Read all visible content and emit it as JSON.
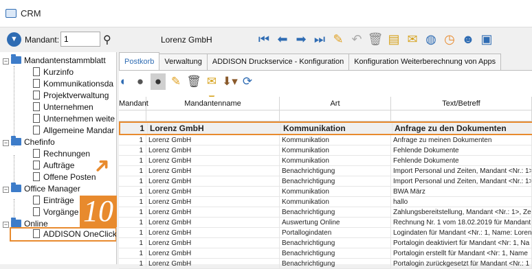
{
  "window": {
    "title": "CRM"
  },
  "toolbar": {
    "mandant_label": "Mandant:",
    "mandant_value": "1",
    "company": "Lorenz GmbH"
  },
  "tree": {
    "groups": [
      {
        "label": "Mandantenstammblatt",
        "items": [
          "Kurzinfo",
          "Kommunikationsda",
          "Projektverwaltung",
          "Unternehmen",
          "Unternehmen weite",
          "Allgemeine Mandar"
        ]
      },
      {
        "label": "Chefinfo",
        "items": [
          "Rechnungen",
          "Aufträge",
          "Offene Posten"
        ]
      },
      {
        "label": "Office Manager",
        "items": [
          "Einträge",
          "Vorgänge"
        ]
      },
      {
        "label": "Online",
        "items": [
          "ADDISON OneClick"
        ]
      }
    ]
  },
  "annotation": {
    "step_number": "10"
  },
  "tabs": [
    {
      "label": "Postkorb",
      "active": true
    },
    {
      "label": "Verwaltung",
      "active": false
    },
    {
      "label": "ADDISON Druckservice - Konfiguration",
      "active": false
    },
    {
      "label": "Konfiguration Weiterberechnung von Apps",
      "active": false
    }
  ],
  "grid": {
    "columns": [
      "Mandant",
      "Mandantenname",
      "Art",
      "Text/Betreff"
    ],
    "rows": [
      [
        "1",
        "Lorenz GmbH",
        "Kommunikation",
        "Anfrage zu den Dokumenten"
      ],
      [
        "1",
        "Lorenz GmbH",
        "Kommunikation",
        "Anfrage zu meinen Dokumenten"
      ],
      [
        "1",
        "Lorenz GmbH",
        "Kommunikation",
        "Fehlende Dokumente"
      ],
      [
        "1",
        "Lorenz GmbH",
        "Kommunikation",
        "Fehlende Dokumente"
      ],
      [
        "1",
        "Lorenz GmbH",
        "Benachrichtigung",
        "Import Personal und Zeiten, Mandant <Nr.: 1>"
      ],
      [
        "1",
        "Lorenz GmbH",
        "Benachrichtigung",
        "Import Personal und Zeiten, Mandant <Nr.: 1>"
      ],
      [
        "1",
        "Lorenz GmbH",
        "Kommunikation",
        "BWA März"
      ],
      [
        "1",
        "Lorenz GmbH",
        "Kommunikation",
        "hallo"
      ],
      [
        "1",
        "Lorenz GmbH",
        "Benachrichtigung",
        "Zahlungsbereitstellung, Mandant <Nr.: 1>, Ze"
      ],
      [
        "1",
        "Lorenz GmbH",
        "Auswertung Online",
        "Rechnung Nr. 1 vom 18.02.2019 für Mandant"
      ],
      [
        "1",
        "Lorenz GmbH",
        "Portallogindaten",
        "Logindaten für Mandant <Nr.: 1, Name: Loren"
      ],
      [
        "1",
        "Lorenz GmbH",
        "Benachrichtigung",
        "Portalogin deaktiviert für Mandant <Nr: 1, Na"
      ],
      [
        "1",
        "Lorenz GmbH",
        "Benachrichtigung",
        "Portalogin erstellt für Mandant <Nr: 1, Name"
      ],
      [
        "1",
        "Lorenz GmbH",
        "Benachrichtigung",
        "Portalogin zurückgesetzt für Mandant <Nr.: 1"
      ]
    ]
  },
  "colors": {
    "accent": "#e88a2d",
    "brand": "#2f6cb3"
  }
}
